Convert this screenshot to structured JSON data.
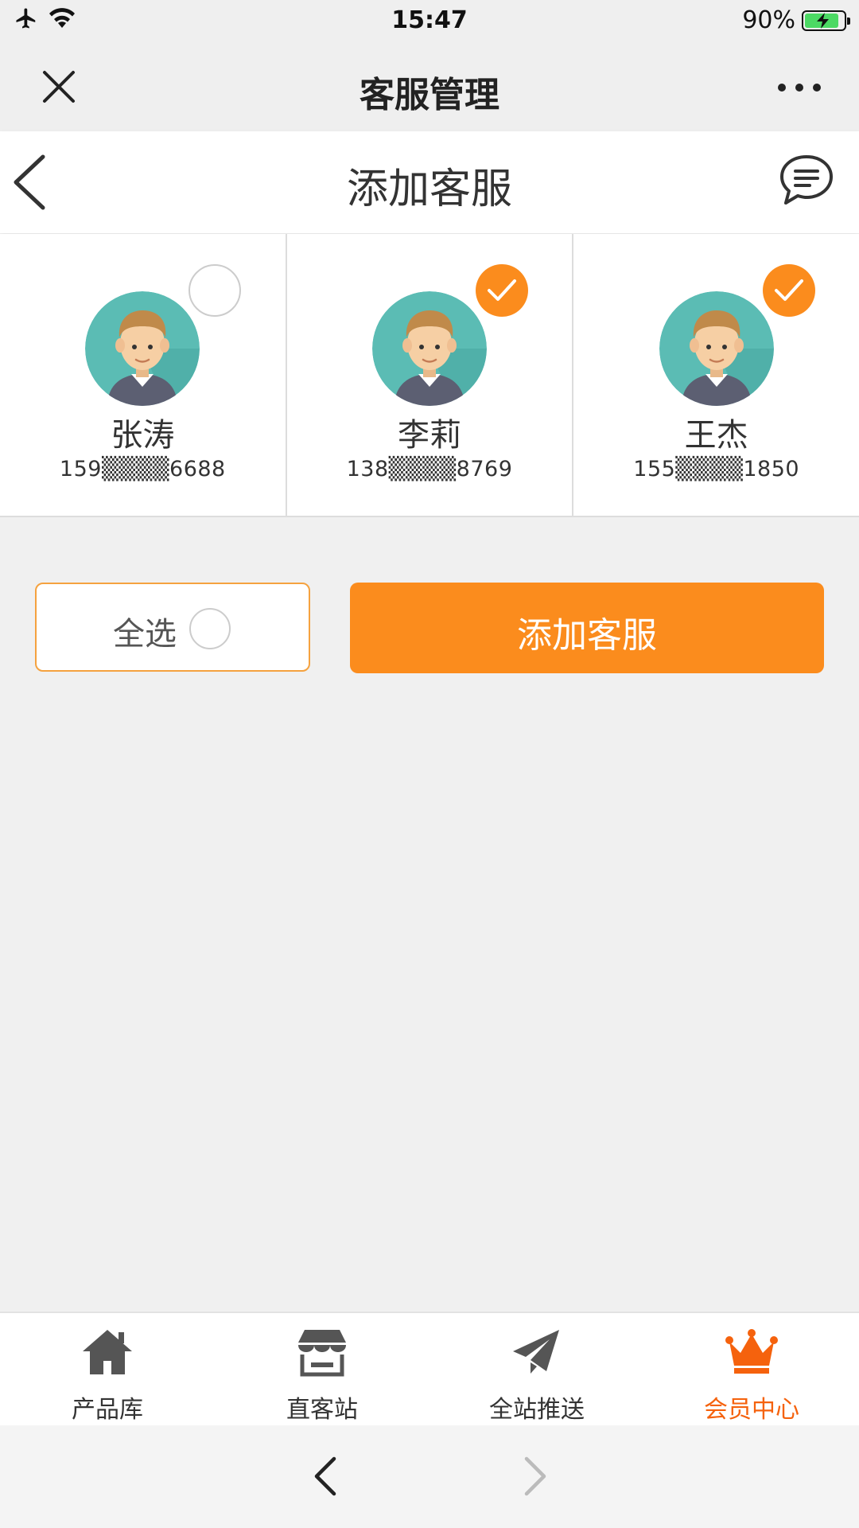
{
  "status_bar": {
    "time": "15:47",
    "battery": "90%"
  },
  "wechat_bar": {
    "title": "客服管理"
  },
  "page": {
    "title": "添加客服"
  },
  "staff": [
    {
      "name": "张涛",
      "phone": "159▒▒▒▒6688",
      "selected": false
    },
    {
      "name": "李莉",
      "phone": "138▒▒▒▒8769",
      "selected": true
    },
    {
      "name": "王杰",
      "phone": "155▒▒▒▒1850",
      "selected": true
    }
  ],
  "actions": {
    "select_all_label": "全选",
    "add_button_label": "添加客服"
  },
  "tabs": [
    {
      "label": "产品库",
      "icon": "home-icon",
      "active": false
    },
    {
      "label": "直客站",
      "icon": "store-icon",
      "active": false
    },
    {
      "label": "全站推送",
      "icon": "paper-plane-icon",
      "active": false
    },
    {
      "label": "会员中心",
      "icon": "crown-icon",
      "active": true
    }
  ],
  "colors": {
    "accent": "#fb8c1d",
    "active_tab": "#f5620d",
    "avatar_bg": "#5bbcb4"
  }
}
